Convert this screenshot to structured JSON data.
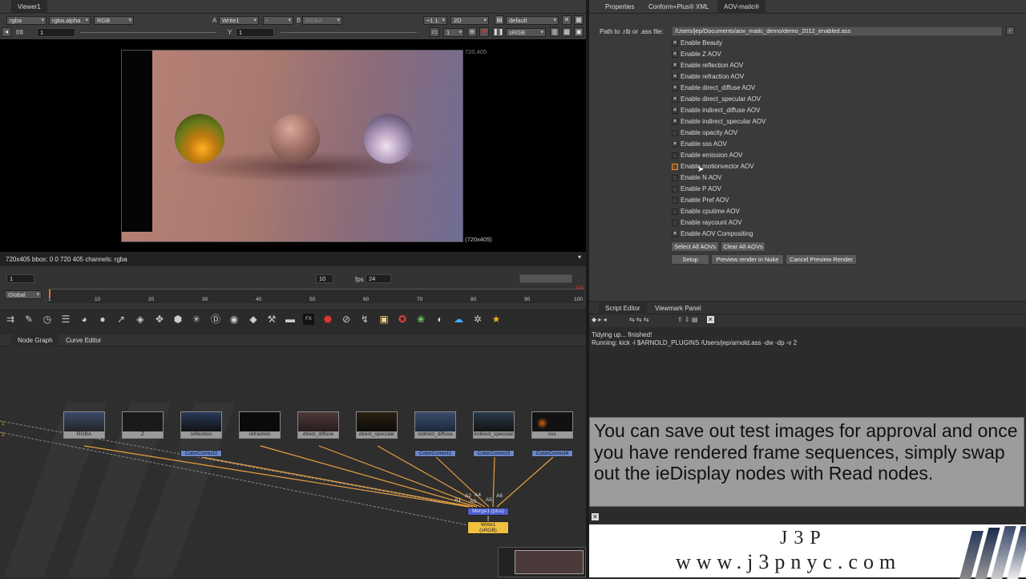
{
  "viewer": {
    "tab": "Viewer1",
    "channels": "rgba",
    "alpha": "rgba.alpha",
    "rgb": "RGB",
    "a_label": "A",
    "a_input": "Write1",
    "dash": "-",
    "b_label": "B",
    "b_input": "RGBA",
    "ratio": "÷1.1:",
    "mode": "2D",
    "lut": "default",
    "fstop": "f/8",
    "fstop_val": "1",
    "y_label": "Y",
    "y_val": "1",
    "frame_small": "1",
    "colorspace": "sRGB",
    "res_top": "720,405",
    "res_bottom": "(720x405)",
    "info": "720x405 bbox: 0 0 720 405 channels: rgba"
  },
  "playback": {
    "frame": "1",
    "step": "10",
    "fps_label": "fps",
    "fps": "24",
    "range_mode": "Global",
    "ticks": [
      "1",
      "10",
      "20",
      "30",
      "40",
      "50",
      "60",
      "70",
      "80",
      "90",
      "100"
    ],
    "end": "100"
  },
  "toolbar": {
    "icons": [
      "read-icon",
      "draw-icon",
      "time-icon",
      "channel-icon",
      "color-icon",
      "filter-icon",
      "keyer-icon",
      "merge-icon",
      "transform-icon",
      "3d-icon",
      "particles-icon",
      "deep-icon",
      "views-icon",
      "metadata-icon",
      "toolsets-icon",
      "other-icon",
      "furnace-icon",
      "ocula-icon",
      "ie-icon",
      "nuke-icon",
      "misc-icon",
      "j3p-icon",
      "sticky-icon",
      "arnold-icon",
      "python-icon",
      "gizmo-icon",
      "cloud-icon",
      "settings-icon",
      "favorite-icon"
    ]
  },
  "nodegraph": {
    "tabs": [
      "Node Graph",
      "Curve Editor"
    ],
    "nodes": [
      {
        "label": "RGBA",
        "cc": ""
      },
      {
        "label": "Z",
        "cc": ""
      },
      {
        "label": "reflection",
        "cc": "ColorCorrect2"
      },
      {
        "label": "refraction",
        "cc": ""
      },
      {
        "label": "direct_diffuse",
        "cc": ""
      },
      {
        "label": "direct_specular",
        "cc": ""
      },
      {
        "label": "indirect_diffuse",
        "cc": "ColorCorrect1"
      },
      {
        "label": "indirect_specular",
        "cc": "ColorCorrect3"
      },
      {
        "label": "sss",
        "cc": "ColorCorrect4"
      }
    ],
    "merge": "Merge1 (plus)",
    "write": "Write1",
    "write_sub": "(sRGB)",
    "input_labels": [
      "A1",
      "A2",
      "A3",
      "A4",
      "A5",
      "A6"
    ],
    "ports": [
      "1",
      "2"
    ]
  },
  "properties": {
    "tabs": [
      "Properties",
      "Conform+Plus® XML",
      "AOV-matic®"
    ],
    "path_label": "Path to .rib or .ass file:",
    "path_value": "/Users/jep/Documents/aov_matic_demo/demo_2012_enabled.ass",
    "options": [
      {
        "label": "Enable Beauty",
        "checked": true
      },
      {
        "label": "Enable Z AOV",
        "checked": true
      },
      {
        "label": "Enable reflection AOV",
        "checked": true
      },
      {
        "label": "Enable refraction AOV",
        "checked": true
      },
      {
        "label": "Enable direct_diffuse AOV",
        "checked": true
      },
      {
        "label": "Enable direct_specular AOV",
        "checked": true
      },
      {
        "label": "Enable indirect_diffuse AOV",
        "checked": true
      },
      {
        "label": "Enable indirect_specular AOV",
        "checked": true
      },
      {
        "label": "Enable opacity AOV",
        "checked": false
      },
      {
        "label": "Enable sss AOV",
        "checked": true
      },
      {
        "label": "Enable emission AOV",
        "checked": false
      },
      {
        "label": "Enable motionvector AOV",
        "checked": false
      },
      {
        "label": "Enable N AOV",
        "checked": false
      },
      {
        "label": "Enable P AOV",
        "checked": false
      },
      {
        "label": "Enable Pref AOV",
        "checked": false
      },
      {
        "label": "Enable cputime AOV",
        "checked": false
      },
      {
        "label": "Enable raycount AOV",
        "checked": false
      },
      {
        "label": "Enable AOV Compositing",
        "checked": true
      }
    ],
    "select_all": "Select All AOVs",
    "clear_all": "Clear All AOVs",
    "setup": "Setup",
    "preview": "Preview render in Nuke",
    "cancel": "Cancel Preview Render"
  },
  "script": {
    "tabs": [
      "Script Editor",
      "Viewmark Panel"
    ],
    "line1": "Tidying up... finished!",
    "line2": "Running: kick -l $ARNOLD_PLUGINS /Users/jep/arnold.ass -dw -dp -v 2"
  },
  "caption": "You can save out test images for approval and once you have rendered frame sequences, simply swap out the ieDisplay nodes with Read nodes.",
  "brand": {
    "name": "J3P",
    "url": "www.j3pnyc.com",
    "close": "✕"
  },
  "colors": {
    "merge": "#4b5fd0",
    "write": "#f0c040",
    "cc": "#6a87c8",
    "wire": "#e8a040"
  }
}
